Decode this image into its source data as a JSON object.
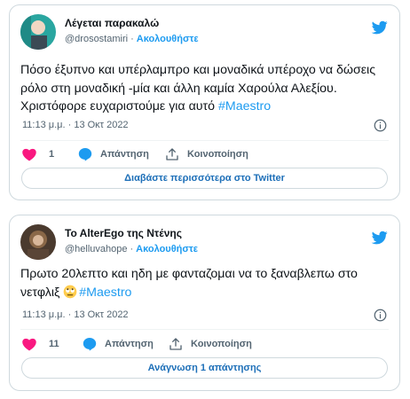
{
  "tweets": [
    {
      "display_name": "Λέγεται παρακαλώ",
      "handle": "@drosostamiri",
      "separator": "·",
      "follow_label": "Ακολουθήστε",
      "text": "Πόσο έξυπνο και υπέρλαμπρο και μοναδικά υπέροχο να δώσεις ρόλο στη μοναδική -μία και άλλη καμία Χαρούλα Αλεξίου. Χριστόφορε ευχαριστούμε για αυτό ",
      "hashtag": "#Maestro",
      "timestamp": "11:13 μ.μ. · 13 Οκτ 2022",
      "likes": "1",
      "reply_label": "Απάντηση",
      "share_label": "Κοινοποίηση",
      "cta_label": "Διαβάστε περισσότερα στο Twitter"
    },
    {
      "display_name": "To AlterEgo της Ντένης",
      "handle": "@helluvahope",
      "separator": "·",
      "follow_label": "Ακολουθήστε",
      "text": "Πρωτο 20λεπτο και ηδη με φανταζομαι να το ξαναβλεπω στο νετφλιξ ",
      "hashtag": "#Maestro",
      "timestamp": "11:13 μ.μ. · 13 Οκτ 2022",
      "likes": "11",
      "reply_label": "Απάντηση",
      "share_label": "Κοινοποίηση",
      "cta_label": "Ανάγνωση 1 απάντησης"
    }
  ],
  "icons": {
    "logo": "twitter-bird-icon",
    "like": "heart-icon",
    "reply": "speech-bubble-icon",
    "share": "share-icon",
    "info": "info-icon",
    "emoji": "rolling-eyes-emoji"
  },
  "colors": {
    "brand_blue": "#1d9bf0",
    "like_pink": "#f91880",
    "text_primary": "#0f1419",
    "text_secondary": "#536471",
    "border": "#cfd9de"
  }
}
